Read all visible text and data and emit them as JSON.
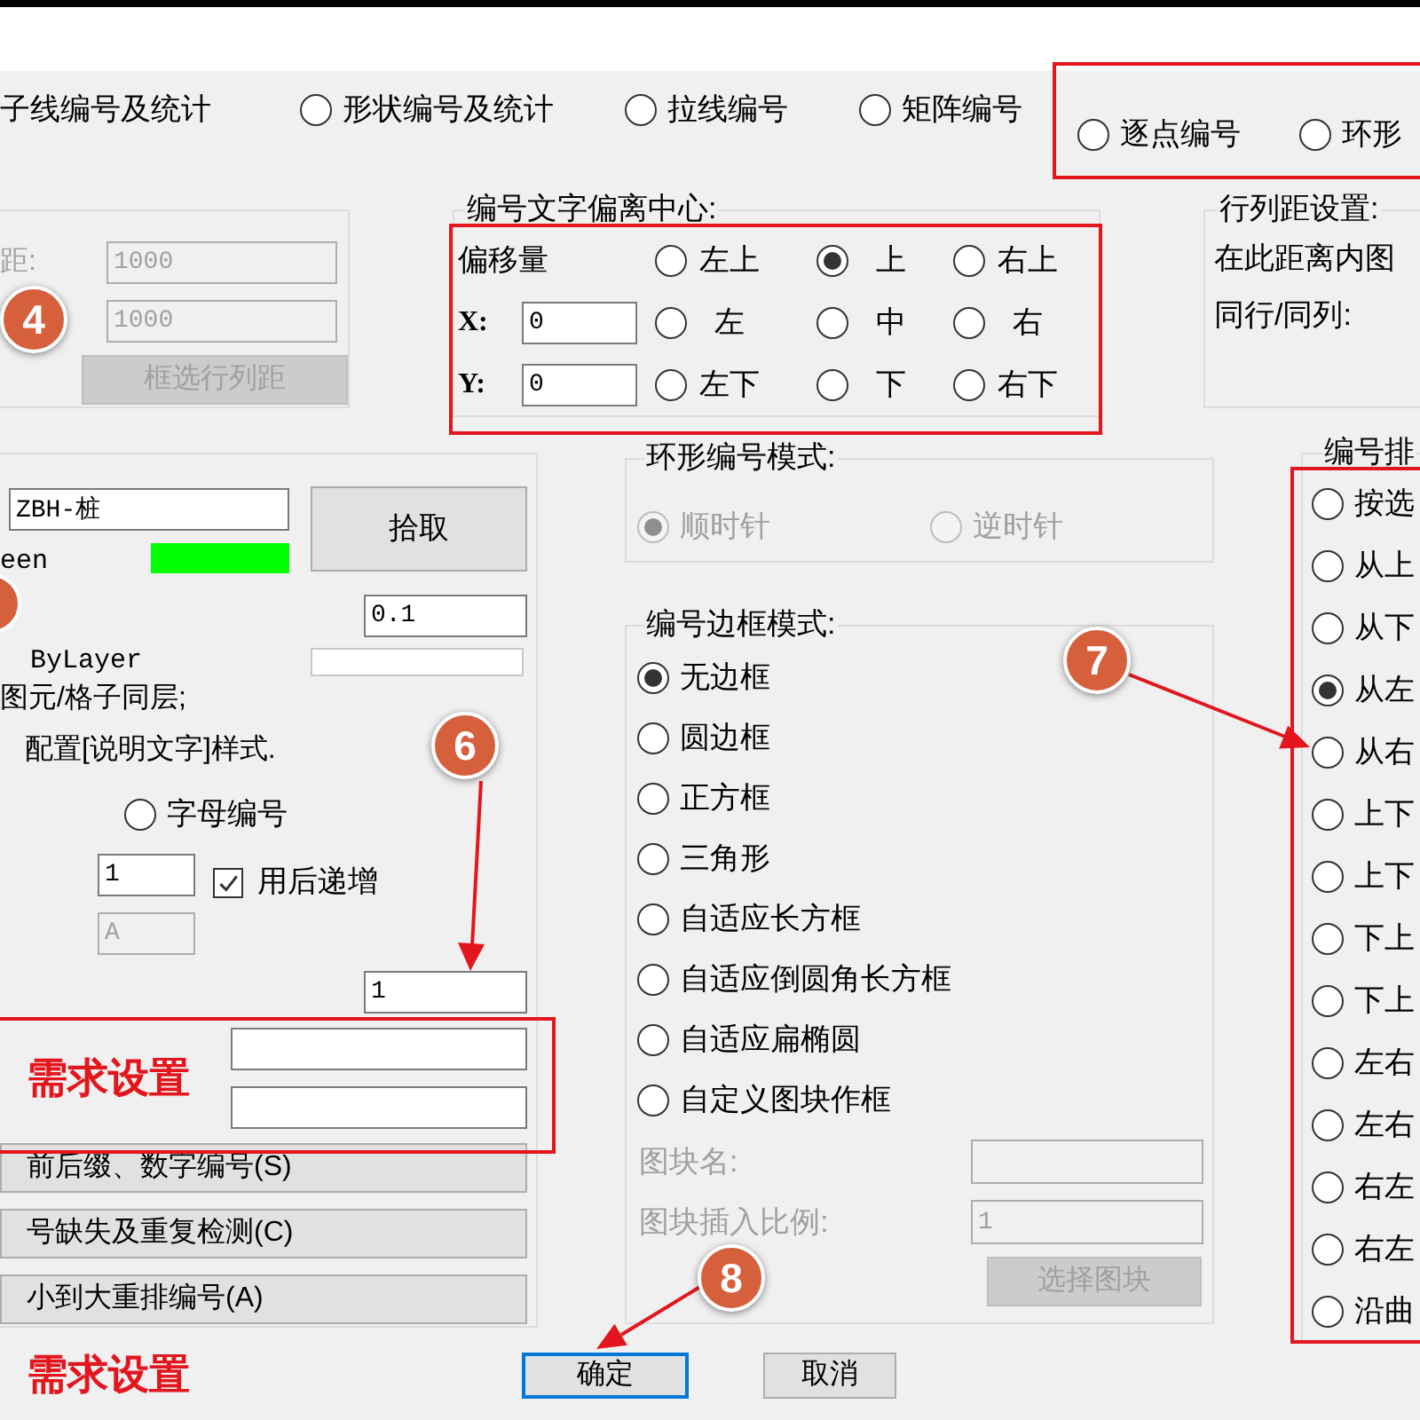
{
  "modes": {
    "cut_label": "子线编号及统计",
    "options": [
      {
        "label": "形状编号及统计",
        "selected": false
      },
      {
        "label": "拉线编号",
        "selected": false
      },
      {
        "label": "矩阵编号",
        "selected": false
      }
    ],
    "highlighted_options": [
      {
        "label": "逐点编号",
        "selected": false
      },
      {
        "label": "环形",
        "selected": false
      }
    ]
  },
  "spacing_group": {
    "label": "距:",
    "disabled": true,
    "values": [
      "1000",
      "1000"
    ],
    "button": "框选行列距",
    "marker": "4"
  },
  "offset_group": {
    "title": "编号文字偏离中心:",
    "highlighted": true,
    "amount_label": "偏移量",
    "x_label": "X:",
    "x_value": "0",
    "y_label": "Y:",
    "y_value": "0",
    "positions": [
      {
        "label": "左上",
        "selected": false
      },
      {
        "label": "上",
        "selected": true
      },
      {
        "label": "右上",
        "selected": false
      },
      {
        "label": "左",
        "selected": false
      },
      {
        "label": "中",
        "selected": false
      },
      {
        "label": "右",
        "selected": false
      },
      {
        "label": "左下",
        "selected": false
      },
      {
        "label": "下",
        "selected": false
      },
      {
        "label": "右下",
        "selected": false
      }
    ]
  },
  "row_col_group": {
    "title": "行列距设置:",
    "lines": [
      "在此距离内图",
      "同行/同列:"
    ]
  },
  "layer_group": {
    "layer_name": "ZBH-桩",
    "color_name": "een",
    "color": "#00ff00",
    "pick_button": "拾取",
    "height_value": "0.1",
    "linetype": "ByLayer",
    "notes": [
      "图元/格子同层;",
      "配置[说明文字]样式."
    ],
    "letter_option": {
      "label": "字母编号",
      "selected": false
    },
    "start_value": "1",
    "letter_value": "A",
    "letter_disabled": true,
    "increment": {
      "label": "用后递增",
      "checked": true
    },
    "step_value": "1",
    "marker": "6",
    "custom_fields": {
      "highlighted": true,
      "note": "需求设置"
    },
    "buttons": [
      "前后缀、数字编号(S)",
      "号缺失及重复检测(C)",
      "小到大重排编号(A)"
    ]
  },
  "ring_mode_group": {
    "title": "环形编号模式:",
    "disabled": true,
    "options": [
      {
        "label": "顺时针",
        "selected": true
      },
      {
        "label": "逆时针",
        "selected": false
      }
    ]
  },
  "frame_mode_group": {
    "title": "编号边框模式:",
    "options": [
      {
        "label": "无边框",
        "selected": true
      },
      {
        "label": "圆边框",
        "selected": false
      },
      {
        "label": "正方框",
        "selected": false
      },
      {
        "label": "三角形",
        "selected": false
      },
      {
        "label": "自适应长方框",
        "selected": false
      },
      {
        "label": "自适应倒圆角长方框",
        "selected": false
      },
      {
        "label": "自适应扁椭圆",
        "selected": false
      },
      {
        "label": "自定义图块作框",
        "selected": false
      }
    ],
    "block_disabled": true,
    "block_name_label": "图块名:",
    "block_scale_label": "图块插入比例:",
    "block_scale_value": "1",
    "select_block_button": "选择图块"
  },
  "order_group": {
    "title": "编号排",
    "highlighted": true,
    "marker": "7",
    "options": [
      {
        "label": "按选",
        "selected": false
      },
      {
        "label": "从上",
        "selected": false
      },
      {
        "label": "从下",
        "selected": false
      },
      {
        "label": "从左",
        "selected": true
      },
      {
        "label": "从右",
        "selected": false
      },
      {
        "label": "上下",
        "selected": false
      },
      {
        "label": "上下",
        "selected": false
      },
      {
        "label": "下上",
        "selected": false
      },
      {
        "label": "下上",
        "selected": false
      },
      {
        "label": "左右",
        "selected": false
      },
      {
        "label": "左右",
        "selected": false
      },
      {
        "label": "右左",
        "selected": false
      },
      {
        "label": "右左",
        "selected": false
      },
      {
        "label": "沿曲",
        "selected": false
      }
    ]
  },
  "footer": {
    "note": "需求设置",
    "marker": "8",
    "buttons": [
      {
        "label": "确定",
        "focused": true
      },
      {
        "label": "取消",
        "focused": false
      }
    ]
  }
}
